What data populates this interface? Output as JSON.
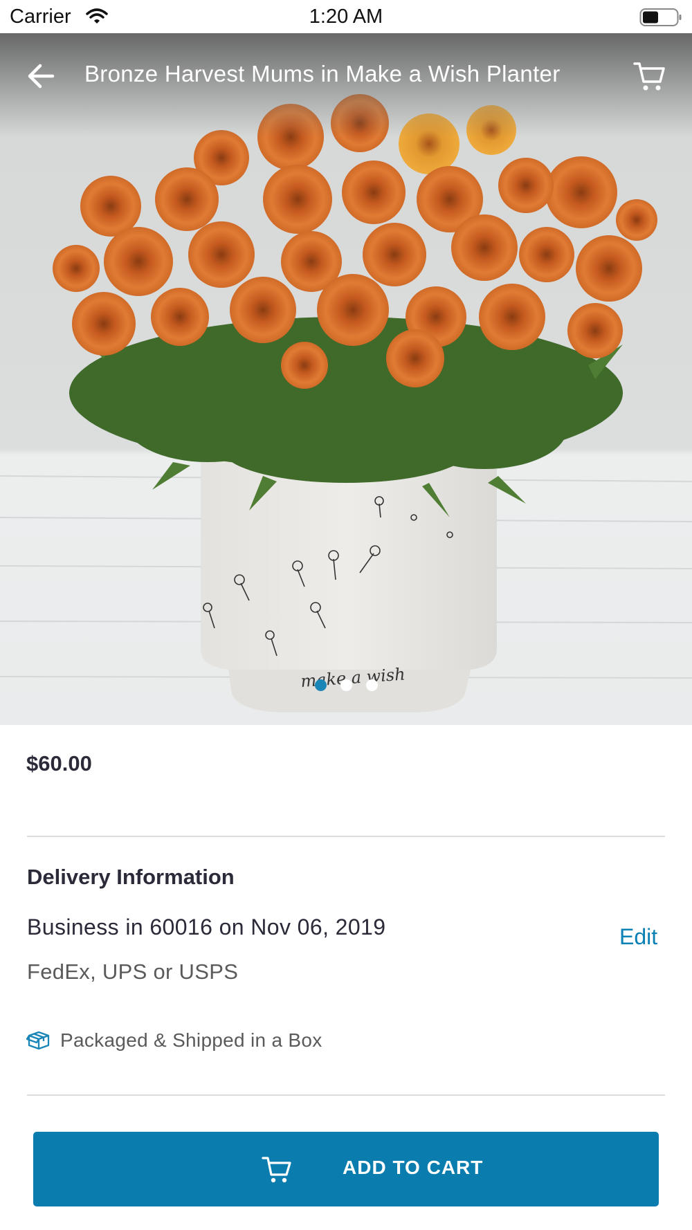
{
  "status_bar": {
    "carrier": "Carrier",
    "time": "1:20 AM",
    "wifi_icon": "wifi-icon",
    "battery_icon": "battery-icon"
  },
  "header": {
    "title": "Bronze Harvest Mums in Make a Wish Planter",
    "back_icon": "arrow-left-icon",
    "cart_icon": "cart-icon"
  },
  "hero": {
    "planter_inscription": "make a wish",
    "image_count": 3,
    "active_image_index": 0
  },
  "product": {
    "price": "$60.00"
  },
  "delivery": {
    "heading": "Delivery Information",
    "summary": "Business in 60016 on Nov 06, 2019",
    "edit_label": "Edit",
    "carriers": "FedEx, UPS or USPS",
    "shipping_note": "Packaged & Shipped in a Box",
    "shipping_icon": "gift-box-icon"
  },
  "actions": {
    "add_to_cart_label": "ADD TO CART",
    "add_to_cart_icon": "cart-icon"
  },
  "colors": {
    "accent": "#0a7cae",
    "link": "#0a80b4",
    "active_dot": "#1a86b8",
    "flower_orange": "#d9702a"
  }
}
